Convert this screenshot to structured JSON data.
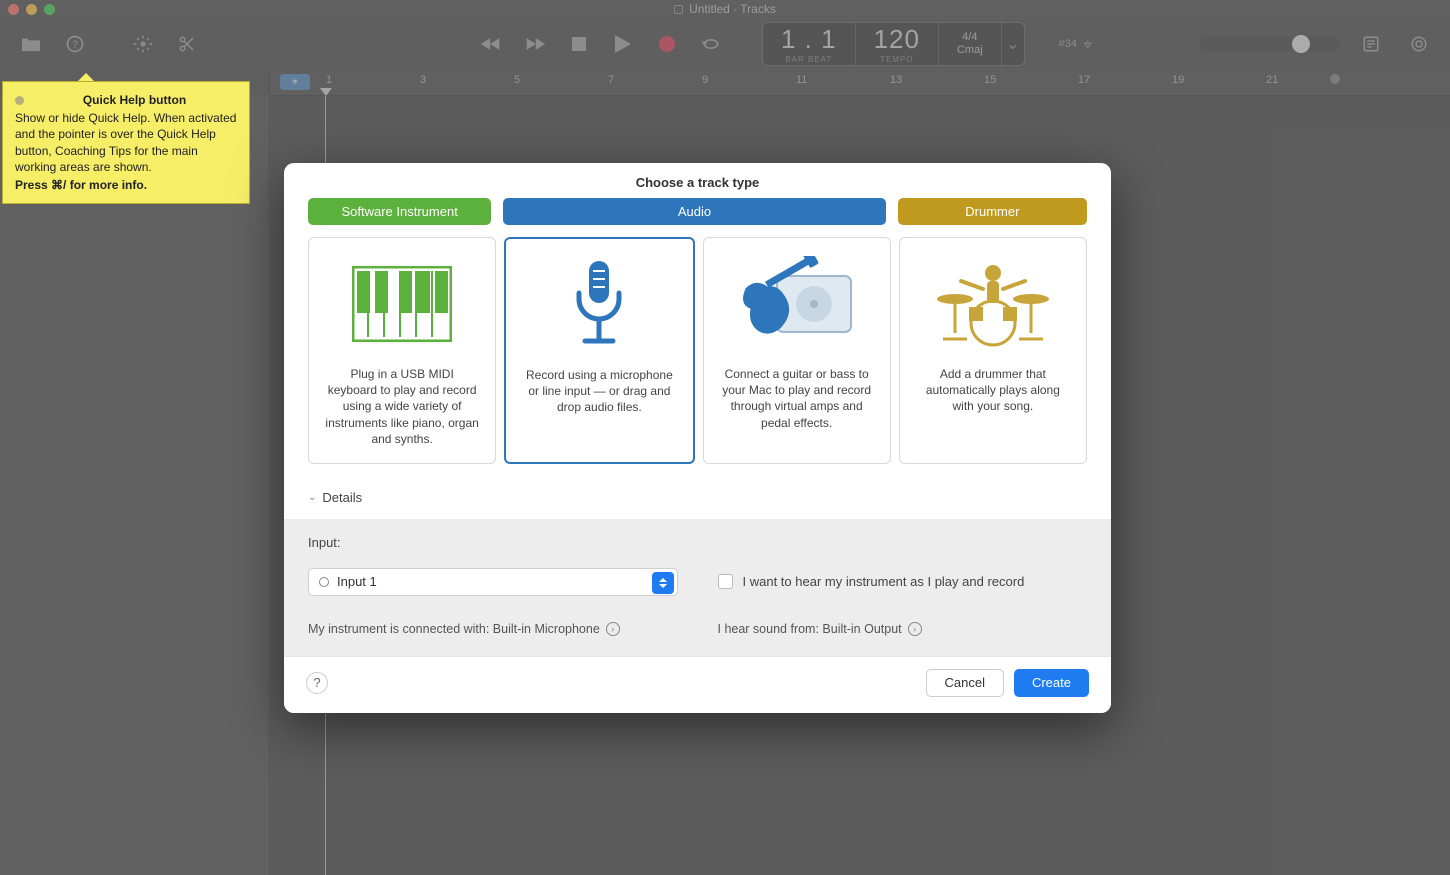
{
  "window": {
    "title": "Untitled · Tracks"
  },
  "lcd": {
    "position": "1 . 1",
    "position_label": "BAR   BEAT",
    "tempo": "120",
    "tempo_label": "TEMPO",
    "sig_top": "4/4",
    "sig_bot": "Cmaj",
    "count": "#34"
  },
  "ruler": {
    "numbers": [
      "1",
      "3",
      "5",
      "7",
      "9",
      "11",
      "13",
      "15",
      "17",
      "19",
      "21"
    ]
  },
  "tooltip": {
    "title": "Quick Help button",
    "body": "Show or hide Quick Help. When activated and the pointer is over the Quick Help button, Coaching Tips for the main working areas are shown.",
    "press": "Press ⌘/ for more info."
  },
  "modal": {
    "title": "Choose a track type",
    "tabs": {
      "software": "Software Instrument",
      "audio": "Audio",
      "drummer": "Drummer"
    },
    "cards": {
      "software": "Plug in a USB MIDI keyboard to play and record using a wide variety of instruments like piano, organ and synths.",
      "mic": "Record using a microphone or line input — or drag and drop audio files.",
      "guitar": "Connect a guitar or bass to your Mac to play and record through virtual amps and pedal effects.",
      "drummer": "Add a drummer that automatically plays along with your song."
    },
    "details_label": "Details",
    "input_label": "Input:",
    "input_value": "Input 1",
    "monitor_label": "I want to hear my instrument as I play and record",
    "conn_prefix": "My instrument is connected with: ",
    "conn_value": "Built-in Microphone",
    "out_prefix": "I hear sound from: ",
    "out_value": "Built-in Output",
    "cancel": "Cancel",
    "create": "Create"
  }
}
